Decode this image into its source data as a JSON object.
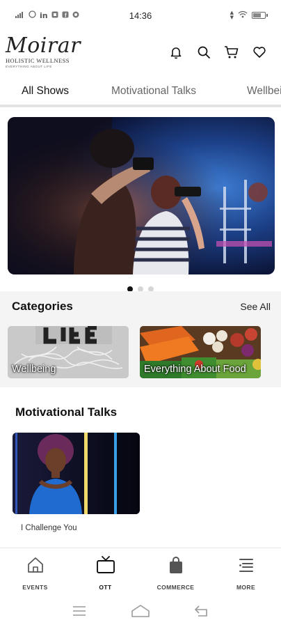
{
  "status_bar": {
    "time": "14:36",
    "left_icons": [
      "signal-icon",
      "whatsapp-icon",
      "linkedin-icon",
      "app-icon",
      "facebook-icon",
      "app-icon-2"
    ],
    "right_icons": [
      "data-speed-icon",
      "wifi-icon",
      "battery-icon"
    ]
  },
  "header": {
    "logo_main": "Moirar",
    "logo_sub": "HOLISTIC WELLNESS",
    "logo_tag": "EVERYTHING ABOUT LIFE",
    "icons": [
      "bell-icon",
      "search-icon",
      "cart-icon",
      "heart-icon"
    ]
  },
  "tabs": [
    {
      "label": "All Shows",
      "active": true
    },
    {
      "label": "Motivational Talks",
      "active": false
    },
    {
      "label": "Wellbeing",
      "active": false
    }
  ],
  "carousel": {
    "slide_count": 3,
    "active_index": 0
  },
  "categories": {
    "title": "Categories",
    "see_all": "See All",
    "items": [
      {
        "label": "Wellbeing"
      },
      {
        "label": "Everything About Food"
      }
    ]
  },
  "motivational_talks": {
    "title": "Motivational Talks",
    "videos": [
      {
        "caption": "I Challenge You"
      }
    ]
  },
  "bottom_nav": {
    "items": [
      {
        "label": "EVENTS",
        "icon": "home-icon"
      },
      {
        "label": "OTT",
        "icon": "tv-icon",
        "active": true
      },
      {
        "label": "COMMERCE",
        "icon": "shopping-bag-icon"
      },
      {
        "label": "MORE",
        "icon": "menu-list-icon"
      }
    ]
  },
  "colors": {
    "accent": "#111111",
    "section_bg": "#f4f4f4",
    "tab_inactive": "#666666"
  }
}
